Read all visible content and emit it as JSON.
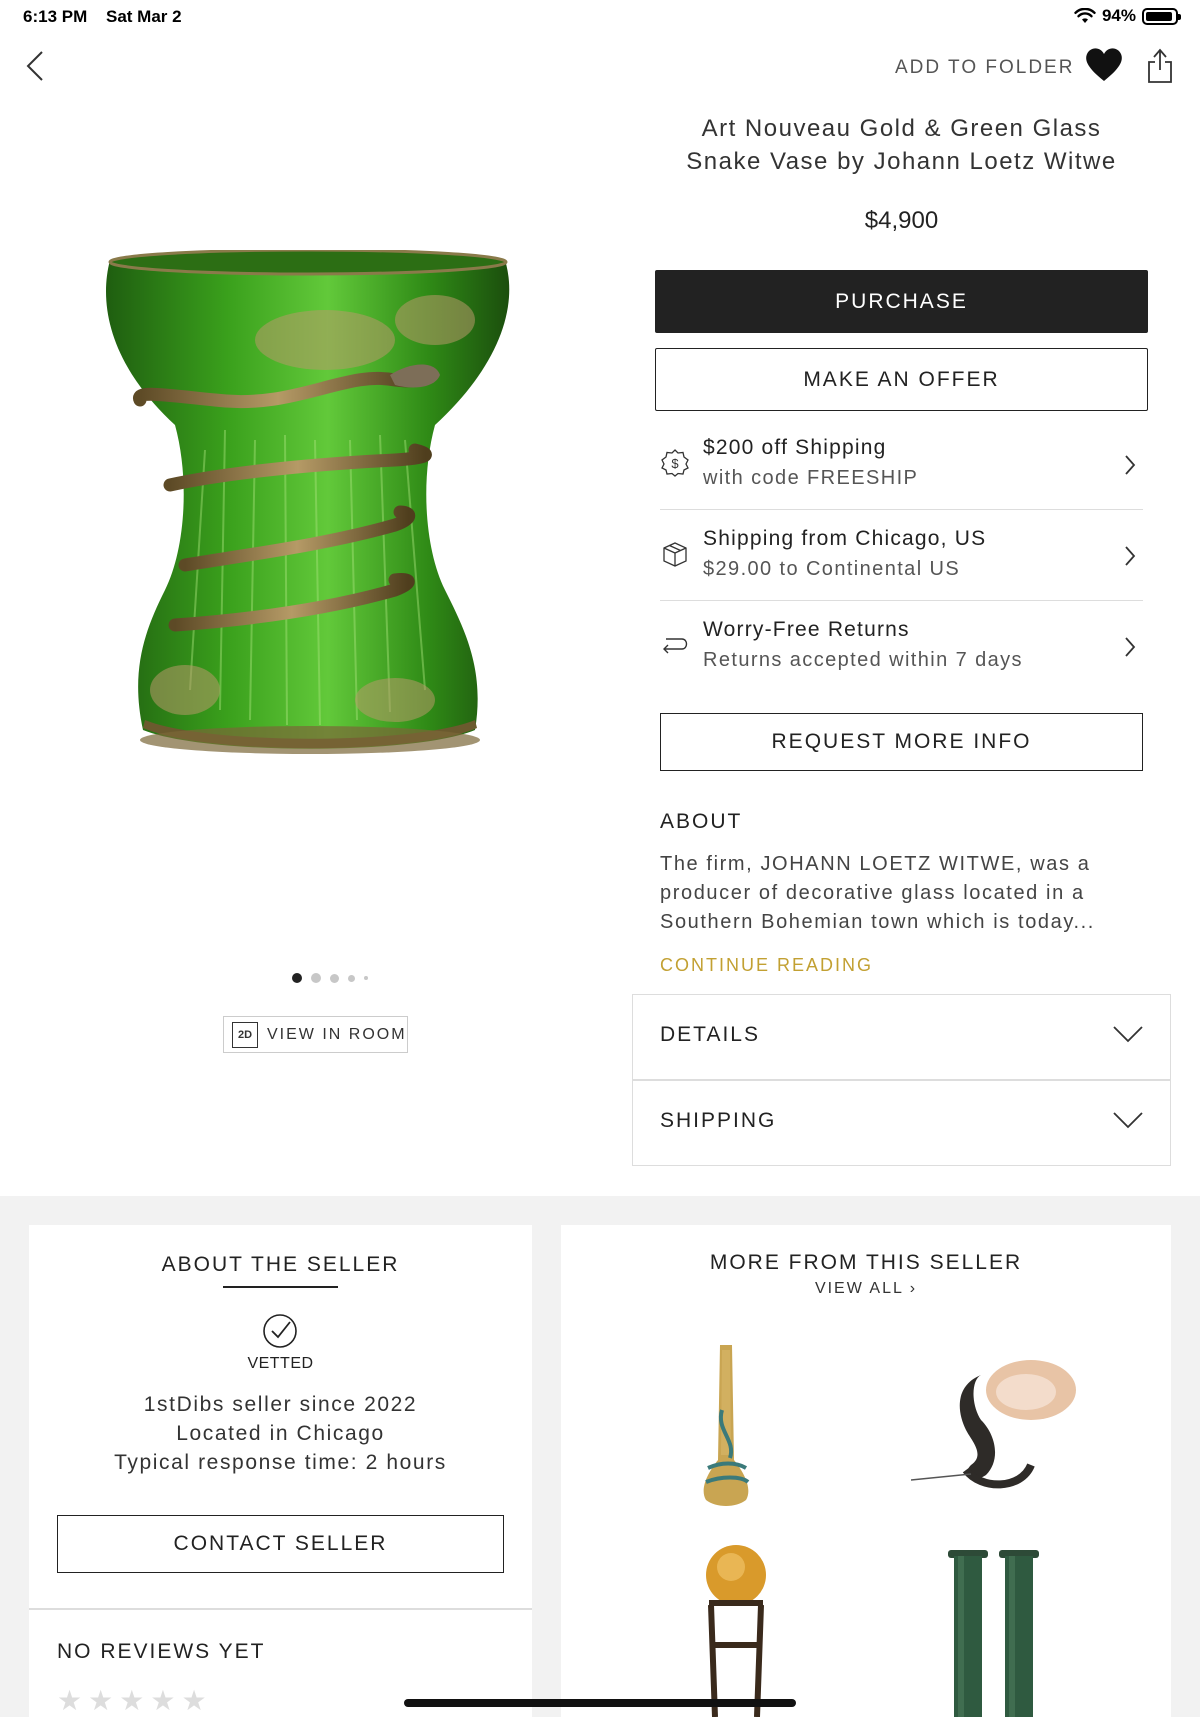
{
  "status_bar": {
    "time": "6:13 PM",
    "date": "Sat Mar 2",
    "battery": "94%",
    "battery_level": 0.94
  },
  "nav": {
    "add_to_folder": "ADD TO FOLDER"
  },
  "product": {
    "title_line1": "Art Nouveau Gold & Green Glass",
    "title_line2": "Snake Vase by Johann Loetz Witwe",
    "price": "$4,900",
    "image_count": 5,
    "active_image": 1,
    "view_in_room_badge": "2D",
    "view_in_room": "VIEW IN ROOM"
  },
  "actions": {
    "purchase": "PURCHASE",
    "make_offer": "MAKE AN OFFER",
    "request_info": "REQUEST MORE INFO"
  },
  "info_rows": [
    {
      "icon": "dollar-badge-icon",
      "line1": "$200 off Shipping",
      "line2": "with code FREESHIP"
    },
    {
      "icon": "package-icon",
      "line1": "Shipping from Chicago, US",
      "line2": "$29.00 to Continental US"
    },
    {
      "icon": "return-arrow-icon",
      "line1": "Worry-Free Returns",
      "line2": "Returns accepted within 7 days"
    }
  ],
  "about": {
    "heading": "ABOUT",
    "body_line1": "The firm, JOHANN LOETZ WITWE, was a",
    "body_line2": "producer of decorative glass located in a",
    "body_line3": "Southern Bohemian town which is today...",
    "continue": "CONTINUE READING"
  },
  "accordions": {
    "details": "DETAILS",
    "shipping": "SHIPPING"
  },
  "seller": {
    "title": "ABOUT THE SELLER",
    "vetted": "VETTED",
    "since": "1stDibs seller since 2022",
    "location": "Located in Chicago",
    "response": "Typical response time: 2 hours",
    "contact": "CONTACT SELLER",
    "reviews": "NO REVIEWS YET",
    "rating": 0
  },
  "more": {
    "title": "MORE FROM THIS SELLER",
    "view_all": "VIEW ALL ›"
  },
  "colors": {
    "accent_gold": "#c2a032",
    "dark_button": "#222222",
    "glass_green": "#3aa01c"
  }
}
